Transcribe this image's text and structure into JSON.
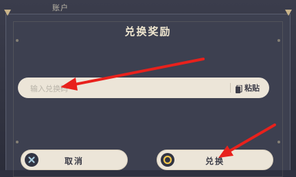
{
  "background": {
    "account_label": "账户"
  },
  "dialog": {
    "title": "兑换奖励",
    "input": {
      "placeholder": "输入兑换码",
      "value": ""
    },
    "paste_label": "粘贴",
    "cancel_label": "取消",
    "confirm_label": "兑换"
  },
  "colors": {
    "dialog_bg": "#3d4050",
    "title": "#efe6cf",
    "field_bg": "#ece5d8",
    "annotation_arrow": "#e8211c"
  },
  "icons": [
    "paste-icon",
    "cancel-x-icon",
    "confirm-circle-icon"
  ]
}
